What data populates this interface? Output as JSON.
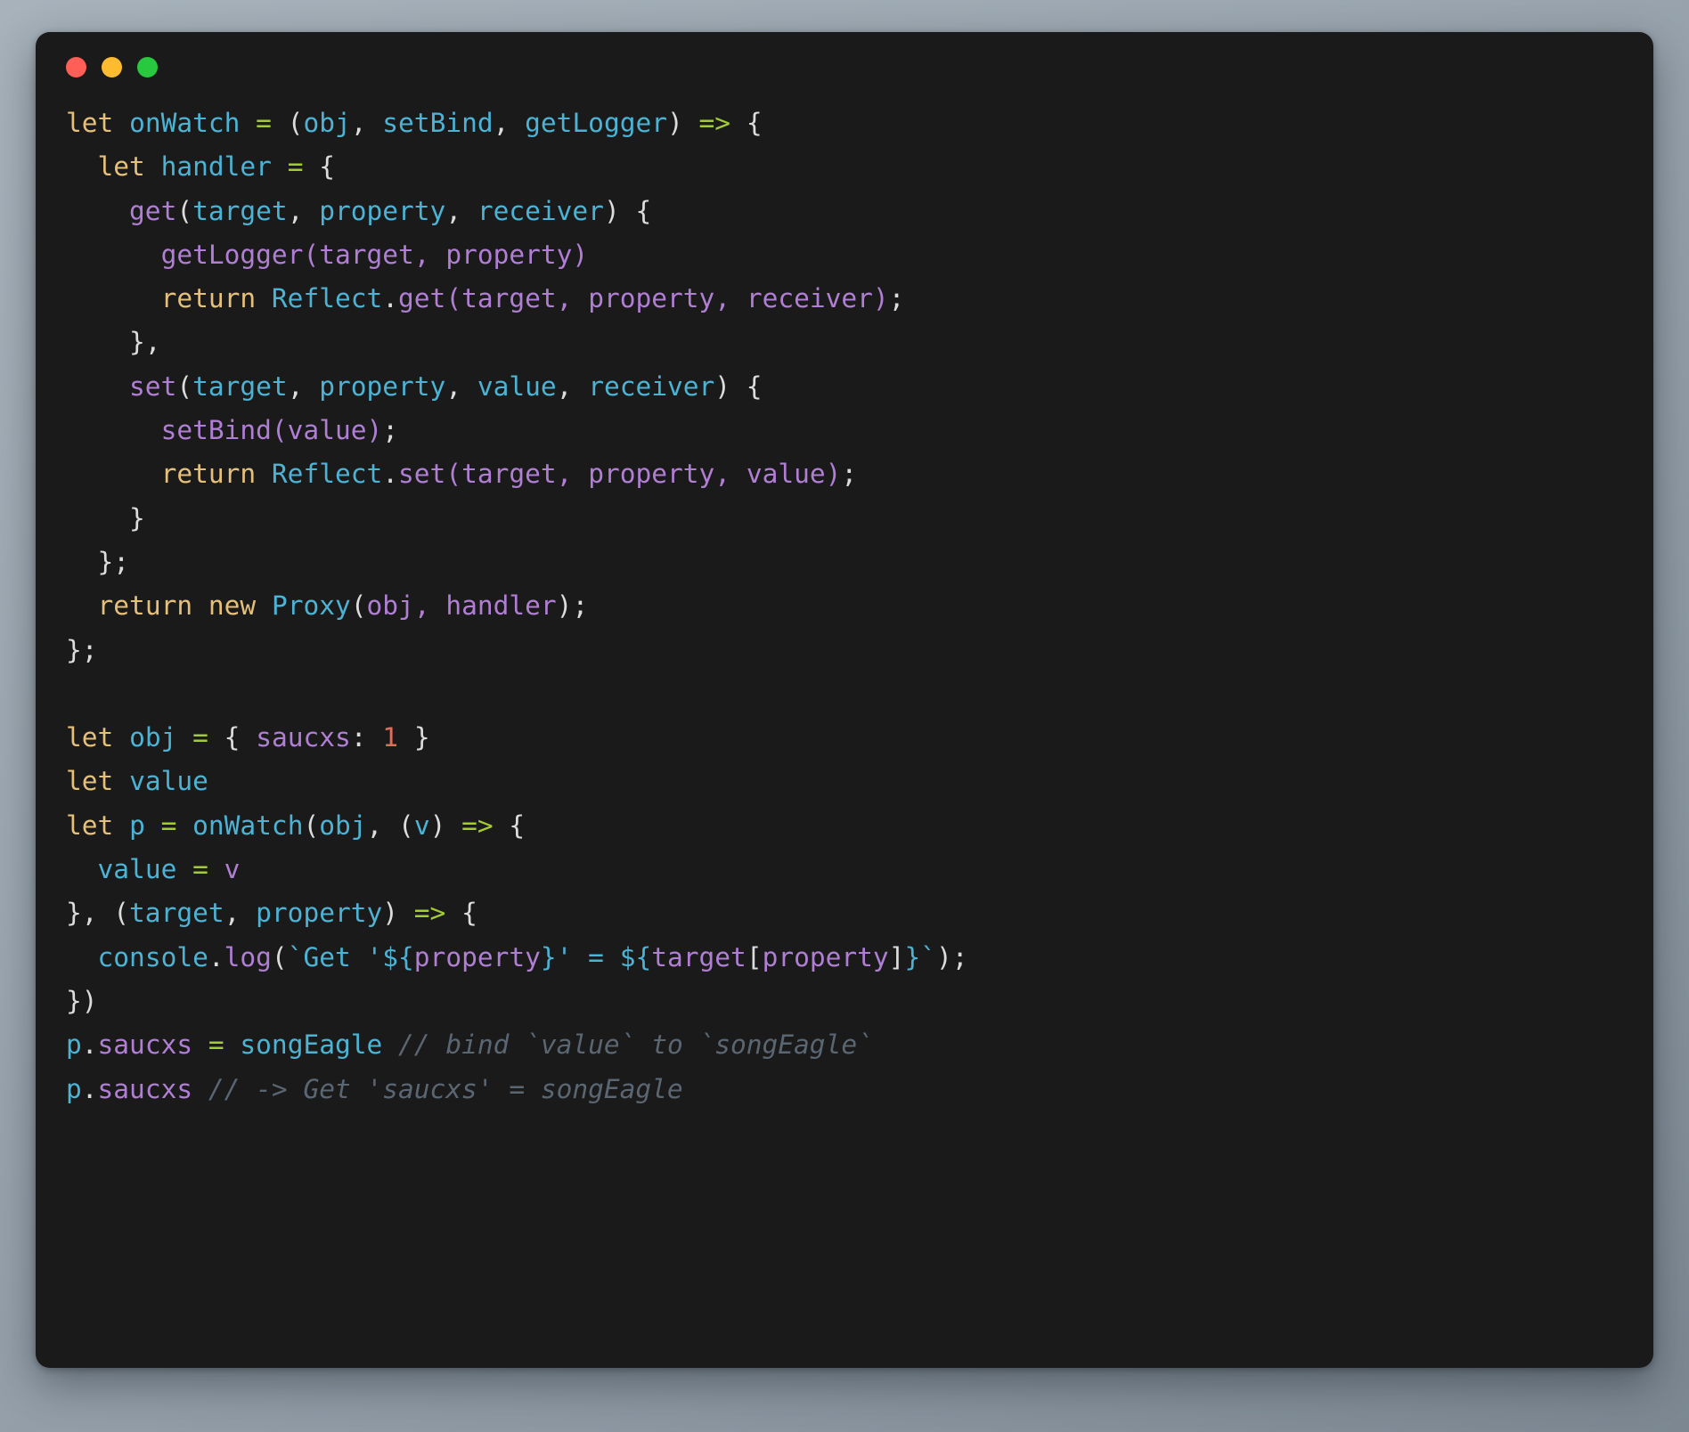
{
  "window": {
    "background_color": "#1a1a1a",
    "page_background_color": "#9ca7b1",
    "controls": [
      {
        "name": "close",
        "color": "#ff5f56"
      },
      {
        "name": "minimize",
        "color": "#fdbc2f"
      },
      {
        "name": "maximize",
        "color": "#28c93f"
      }
    ]
  },
  "theme": {
    "keyword_color": "#e5c07b",
    "identifier_color": "#4cb3d4",
    "operator_color": "#a3cb38",
    "punctuation_color": "#dcdcdc",
    "function_color": "#b07fd4",
    "number_color": "#e06c5a",
    "comment_color": "#5a6672"
  },
  "code": {
    "language": "javascript",
    "plain_text": "let onWatch = (obj, setBind, getLogger) => {\n  let handler = {\n    get(target, property, receiver) {\n      getLogger(target, property)\n      return Reflect.get(target, property, receiver);\n    },\n    set(target, property, value, receiver) {\n      setBind(value);\n      return Reflect.set(target, property, value);\n    }\n  };\n  return new Proxy(obj, handler);\n};\n\nlet obj = { saucxs: 1 }\nlet value\nlet p = onWatch(obj, (v) => {\n  value = v\n}, (target, property) => {\n  console.log(`Get '${property}' = ${target[property]}`);\n})\np.saucxs = songEagle // bind `value` to `songEagle`\np.saucxs // -> Get 'saucxs' = songEagle",
    "lines": [
      {
        "n": 1,
        "tokens": [
          {
            "t": "let",
            "c": "kw"
          },
          {
            "t": " ",
            "c": "pun"
          },
          {
            "t": "onWatch",
            "c": "id"
          },
          {
            "t": " ",
            "c": "pun"
          },
          {
            "t": "=",
            "c": "op"
          },
          {
            "t": " (",
            "c": "pun"
          },
          {
            "t": "obj",
            "c": "id"
          },
          {
            "t": ", ",
            "c": "pun"
          },
          {
            "t": "setBind",
            "c": "id"
          },
          {
            "t": ", ",
            "c": "pun"
          },
          {
            "t": "getLogger",
            "c": "id"
          },
          {
            "t": ") ",
            "c": "pun"
          },
          {
            "t": "=>",
            "c": "op"
          },
          {
            "t": " {",
            "c": "pun"
          }
        ]
      },
      {
        "n": 2,
        "tokens": [
          {
            "t": "  ",
            "c": "pun"
          },
          {
            "t": "let",
            "c": "kw"
          },
          {
            "t": " ",
            "c": "pun"
          },
          {
            "t": "handler",
            "c": "id"
          },
          {
            "t": " ",
            "c": "pun"
          },
          {
            "t": "=",
            "c": "op"
          },
          {
            "t": " {",
            "c": "pun"
          }
        ]
      },
      {
        "n": 3,
        "tokens": [
          {
            "t": "    ",
            "c": "pun"
          },
          {
            "t": "get",
            "c": "fn"
          },
          {
            "t": "(",
            "c": "pun"
          },
          {
            "t": "target",
            "c": "id"
          },
          {
            "t": ", ",
            "c": "pun"
          },
          {
            "t": "property",
            "c": "id"
          },
          {
            "t": ", ",
            "c": "pun"
          },
          {
            "t": "receiver",
            "c": "id"
          },
          {
            "t": ") {",
            "c": "pun"
          }
        ]
      },
      {
        "n": 4,
        "tokens": [
          {
            "t": "      ",
            "c": "pun"
          },
          {
            "t": "getLogger",
            "c": "fn"
          },
          {
            "t": "(",
            "c": "fn"
          },
          {
            "t": "target",
            "c": "fn"
          },
          {
            "t": ", ",
            "c": "fn"
          },
          {
            "t": "property",
            "c": "fn"
          },
          {
            "t": ")",
            "c": "fn"
          }
        ]
      },
      {
        "n": 5,
        "tokens": [
          {
            "t": "      ",
            "c": "pun"
          },
          {
            "t": "return",
            "c": "kw"
          },
          {
            "t": " ",
            "c": "pun"
          },
          {
            "t": "Reflect",
            "c": "id"
          },
          {
            "t": ".",
            "c": "pun"
          },
          {
            "t": "get",
            "c": "fn"
          },
          {
            "t": "(",
            "c": "fn"
          },
          {
            "t": "target",
            "c": "fn"
          },
          {
            "t": ", ",
            "c": "fn"
          },
          {
            "t": "property",
            "c": "fn"
          },
          {
            "t": ", ",
            "c": "fn"
          },
          {
            "t": "receiver",
            "c": "fn"
          },
          {
            "t": ")",
            "c": "fn"
          },
          {
            "t": ";",
            "c": "pun"
          }
        ]
      },
      {
        "n": 6,
        "tokens": [
          {
            "t": "    },",
            "c": "pun"
          }
        ]
      },
      {
        "n": 7,
        "tokens": [
          {
            "t": "    ",
            "c": "pun"
          },
          {
            "t": "set",
            "c": "fn"
          },
          {
            "t": "(",
            "c": "pun"
          },
          {
            "t": "target",
            "c": "id"
          },
          {
            "t": ", ",
            "c": "pun"
          },
          {
            "t": "property",
            "c": "id"
          },
          {
            "t": ", ",
            "c": "pun"
          },
          {
            "t": "value",
            "c": "id"
          },
          {
            "t": ", ",
            "c": "pun"
          },
          {
            "t": "receiver",
            "c": "id"
          },
          {
            "t": ") {",
            "c": "pun"
          }
        ]
      },
      {
        "n": 8,
        "tokens": [
          {
            "t": "      ",
            "c": "pun"
          },
          {
            "t": "setBind",
            "c": "fn"
          },
          {
            "t": "(",
            "c": "fn"
          },
          {
            "t": "value",
            "c": "fn"
          },
          {
            "t": ")",
            "c": "fn"
          },
          {
            "t": ";",
            "c": "pun"
          }
        ]
      },
      {
        "n": 9,
        "tokens": [
          {
            "t": "      ",
            "c": "pun"
          },
          {
            "t": "return",
            "c": "kw"
          },
          {
            "t": " ",
            "c": "pun"
          },
          {
            "t": "Reflect",
            "c": "id"
          },
          {
            "t": ".",
            "c": "pun"
          },
          {
            "t": "set",
            "c": "fn"
          },
          {
            "t": "(",
            "c": "fn"
          },
          {
            "t": "target",
            "c": "fn"
          },
          {
            "t": ", ",
            "c": "fn"
          },
          {
            "t": "property",
            "c": "fn"
          },
          {
            "t": ", ",
            "c": "fn"
          },
          {
            "t": "value",
            "c": "fn"
          },
          {
            "t": ")",
            "c": "fn"
          },
          {
            "t": ";",
            "c": "pun"
          }
        ]
      },
      {
        "n": 10,
        "tokens": [
          {
            "t": "    }",
            "c": "pun"
          }
        ]
      },
      {
        "n": 11,
        "tokens": [
          {
            "t": "  };",
            "c": "pun"
          }
        ]
      },
      {
        "n": 12,
        "tokens": [
          {
            "t": "  ",
            "c": "pun"
          },
          {
            "t": "return",
            "c": "kw"
          },
          {
            "t": " ",
            "c": "pun"
          },
          {
            "t": "new",
            "c": "kw"
          },
          {
            "t": " ",
            "c": "pun"
          },
          {
            "t": "Proxy",
            "c": "id"
          },
          {
            "t": "(",
            "c": "pun"
          },
          {
            "t": "obj",
            "c": "fn"
          },
          {
            "t": ", ",
            "c": "fn"
          },
          {
            "t": "handler",
            "c": "fn"
          },
          {
            "t": ")",
            "c": "pun"
          },
          {
            "t": ";",
            "c": "pun"
          }
        ]
      },
      {
        "n": 13,
        "tokens": [
          {
            "t": "};",
            "c": "pun"
          }
        ]
      },
      {
        "n": 14,
        "tokens": [
          {
            "t": "",
            "c": "pun"
          }
        ]
      },
      {
        "n": 15,
        "tokens": [
          {
            "t": "let",
            "c": "kw"
          },
          {
            "t": " ",
            "c": "pun"
          },
          {
            "t": "obj",
            "c": "id"
          },
          {
            "t": " ",
            "c": "pun"
          },
          {
            "t": "=",
            "c": "op"
          },
          {
            "t": " { ",
            "c": "pun"
          },
          {
            "t": "saucxs",
            "c": "fn"
          },
          {
            "t": ": ",
            "c": "pun"
          },
          {
            "t": "1",
            "c": "num"
          },
          {
            "t": " }",
            "c": "pun"
          }
        ]
      },
      {
        "n": 16,
        "tokens": [
          {
            "t": "let",
            "c": "kw"
          },
          {
            "t": " ",
            "c": "pun"
          },
          {
            "t": "value",
            "c": "id"
          }
        ]
      },
      {
        "n": 17,
        "tokens": [
          {
            "t": "let",
            "c": "kw"
          },
          {
            "t": " ",
            "c": "pun"
          },
          {
            "t": "p",
            "c": "id"
          },
          {
            "t": " ",
            "c": "pun"
          },
          {
            "t": "=",
            "c": "op"
          },
          {
            "t": " ",
            "c": "pun"
          },
          {
            "t": "onWatch",
            "c": "id"
          },
          {
            "t": "(",
            "c": "pun"
          },
          {
            "t": "obj",
            "c": "id"
          },
          {
            "t": ", (",
            "c": "pun"
          },
          {
            "t": "v",
            "c": "id"
          },
          {
            "t": ") ",
            "c": "pun"
          },
          {
            "t": "=>",
            "c": "op"
          },
          {
            "t": " {",
            "c": "pun"
          }
        ]
      },
      {
        "n": 18,
        "tokens": [
          {
            "t": "  ",
            "c": "pun"
          },
          {
            "t": "value",
            "c": "id"
          },
          {
            "t": " ",
            "c": "pun"
          },
          {
            "t": "=",
            "c": "op"
          },
          {
            "t": " ",
            "c": "pun"
          },
          {
            "t": "v",
            "c": "fn"
          }
        ]
      },
      {
        "n": 19,
        "tokens": [
          {
            "t": "}, (",
            "c": "pun"
          },
          {
            "t": "target",
            "c": "id"
          },
          {
            "t": ", ",
            "c": "pun"
          },
          {
            "t": "property",
            "c": "id"
          },
          {
            "t": ") ",
            "c": "pun"
          },
          {
            "t": "=>",
            "c": "op"
          },
          {
            "t": " {",
            "c": "pun"
          }
        ]
      },
      {
        "n": 20,
        "tokens": [
          {
            "t": "  ",
            "c": "pun"
          },
          {
            "t": "console",
            "c": "id"
          },
          {
            "t": ".",
            "c": "pun"
          },
          {
            "t": "log",
            "c": "fn"
          },
          {
            "t": "(",
            "c": "pun"
          },
          {
            "t": "`Get '",
            "c": "id"
          },
          {
            "t": "${",
            "c": "id"
          },
          {
            "t": "property",
            "c": "fn"
          },
          {
            "t": "}",
            "c": "id"
          },
          {
            "t": "' = ",
            "c": "id"
          },
          {
            "t": "${",
            "c": "id"
          },
          {
            "t": "target",
            "c": "fn"
          },
          {
            "t": "[",
            "c": "pun"
          },
          {
            "t": "property",
            "c": "fn"
          },
          {
            "t": "]",
            "c": "pun"
          },
          {
            "t": "}",
            "c": "id"
          },
          {
            "t": "`",
            "c": "id"
          },
          {
            "t": ")",
            "c": "pun"
          },
          {
            "t": ";",
            "c": "pun"
          }
        ]
      },
      {
        "n": 21,
        "tokens": [
          {
            "t": "})",
            "c": "pun"
          }
        ]
      },
      {
        "n": 22,
        "tokens": [
          {
            "t": "p",
            "c": "id"
          },
          {
            "t": ".",
            "c": "pun"
          },
          {
            "t": "saucxs",
            "c": "fn"
          },
          {
            "t": " ",
            "c": "pun"
          },
          {
            "t": "=",
            "c": "op"
          },
          {
            "t": " ",
            "c": "pun"
          },
          {
            "t": "songEagle",
            "c": "id"
          },
          {
            "t": " ",
            "c": "pun"
          },
          {
            "t": "// bind `value` to `songEagle`",
            "c": "cmt"
          }
        ]
      },
      {
        "n": 23,
        "tokens": [
          {
            "t": "p",
            "c": "id"
          },
          {
            "t": ".",
            "c": "pun"
          },
          {
            "t": "saucxs",
            "c": "fn"
          },
          {
            "t": " ",
            "c": "pun"
          },
          {
            "t": "// -> Get 'saucxs' = songEagle",
            "c": "cmt"
          }
        ]
      }
    ]
  }
}
